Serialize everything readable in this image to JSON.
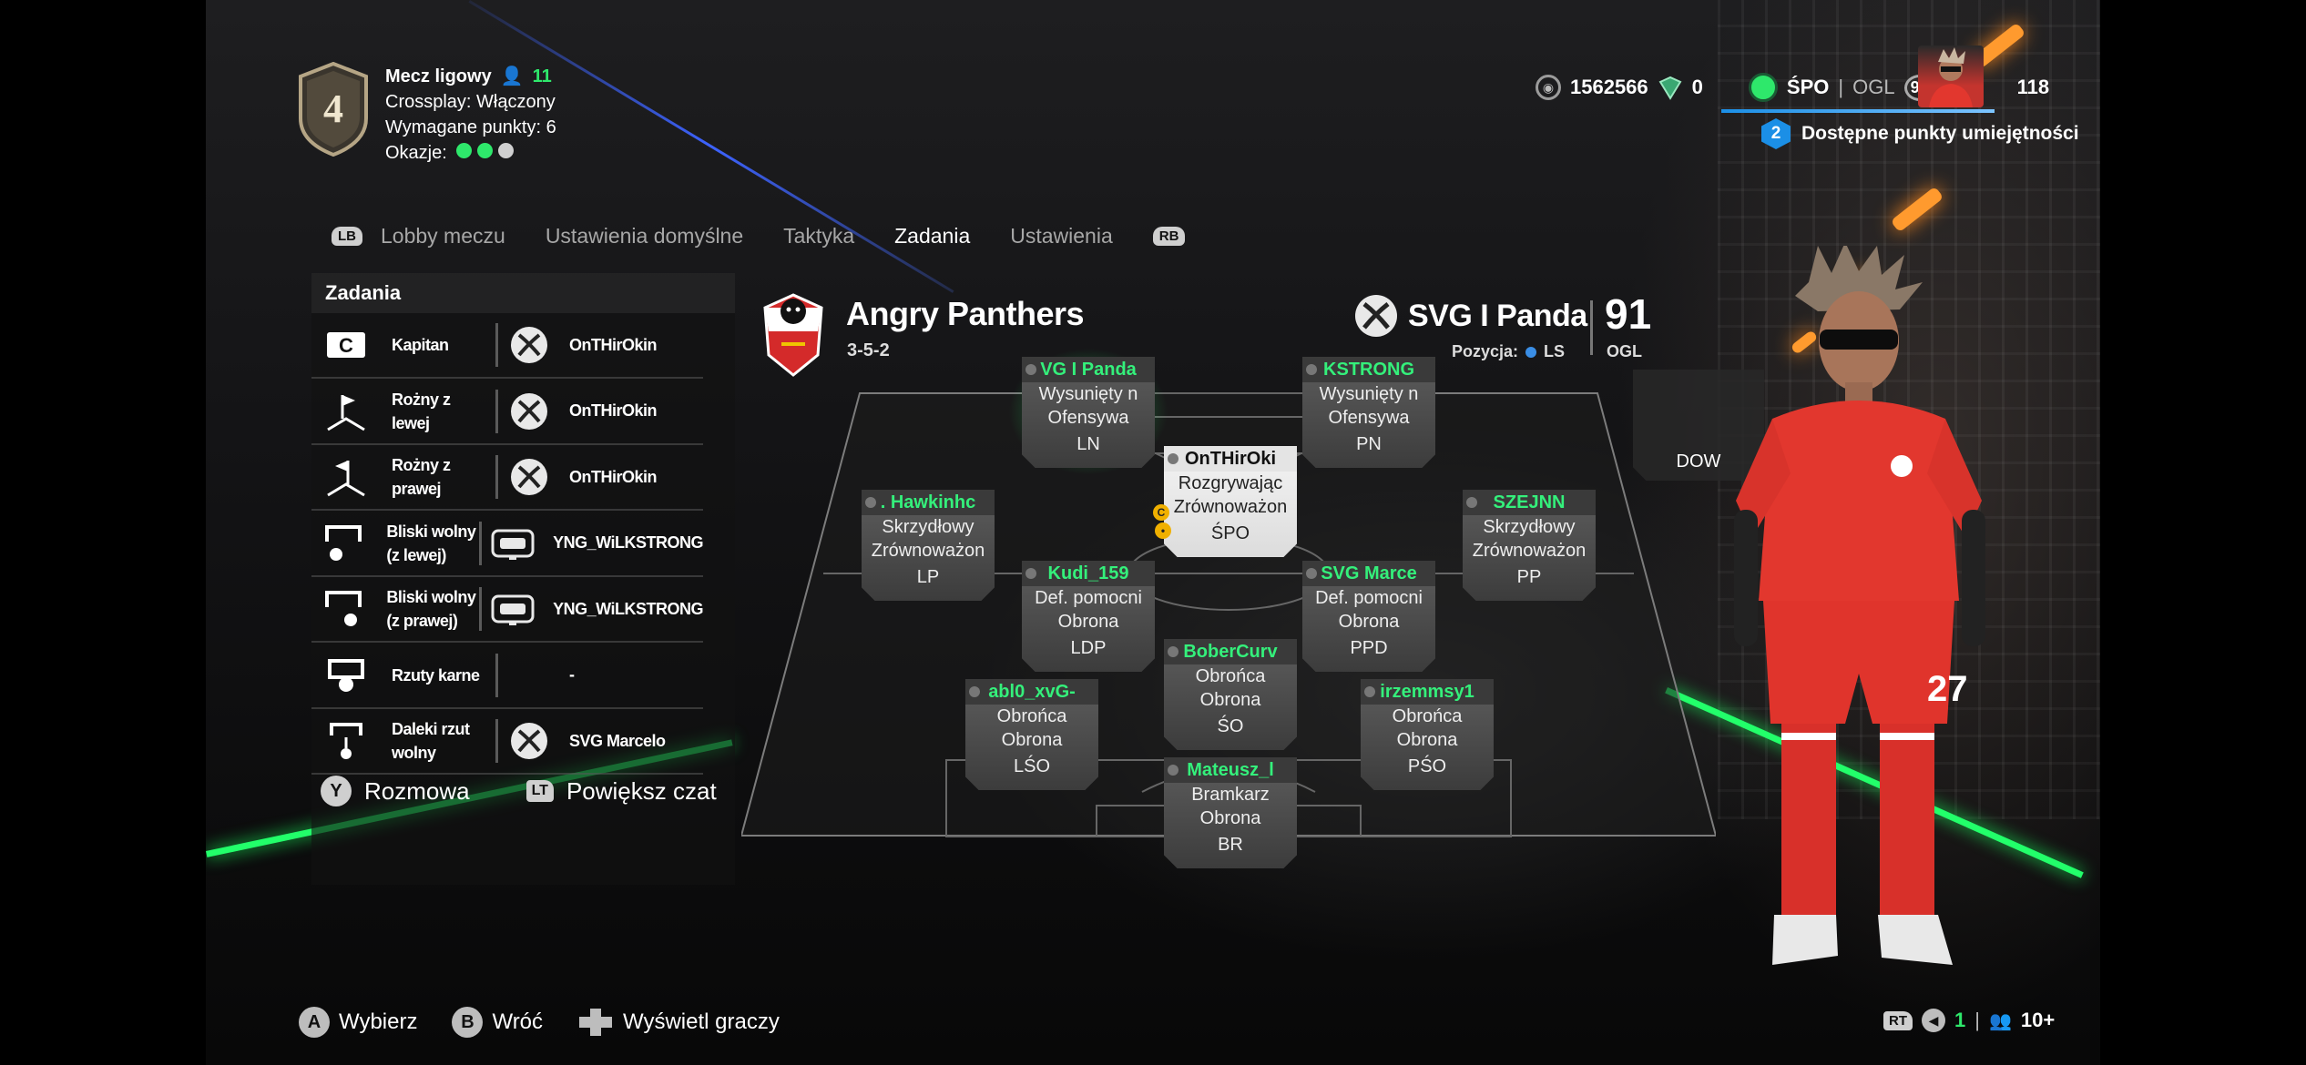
{
  "match": {
    "type_label": "Mecz ligowy",
    "players_count": "11",
    "crossplay": "Crossplay: Włączony",
    "required_points": "Wymagane punkty: 6",
    "chances_label": "Okazje:",
    "chances": [
      "#2ee86b",
      "#2ee86b",
      "#d0d0d0"
    ],
    "rank": "4"
  },
  "currency": {
    "coins": "1562566",
    "points": "0",
    "position": "ŚPO",
    "ovr_label": "OGL",
    "ovr": "92",
    "level": "118"
  },
  "skill_points": {
    "count": "2",
    "label": "Dostępne punkty umiejętności"
  },
  "tabs": {
    "left_bumper": "LB",
    "right_bumper": "RB",
    "items": [
      {
        "label": "Lobby meczu"
      },
      {
        "label": "Ustawienia domyślne"
      },
      {
        "label": "Taktyka"
      },
      {
        "label": "Zadania"
      },
      {
        "label": "Ustawienia"
      }
    ]
  },
  "tasks": {
    "title": "Zadania",
    "rows": [
      {
        "icon": "captain-icon",
        "label": "Kapitan",
        "platform": "xbox-icon",
        "player": "OnTHirOkin"
      },
      {
        "icon": "corner-left-icon",
        "label": "Rożny z lewej",
        "platform": "xbox-icon",
        "player": "OnTHirOkin"
      },
      {
        "icon": "corner-right-icon",
        "label": "Rożny z prawej",
        "platform": "xbox-icon",
        "player": "OnTHirOkin"
      },
      {
        "icon": "free-kick-near-left-icon",
        "label": "Bliski wolny (z lewej)",
        "platform": "playstation-icon",
        "player": "YNG_WiLKSTRONG"
      },
      {
        "icon": "free-kick-near-right-icon",
        "label": "Bliski wolny (z prawej)",
        "platform": "playstation-icon",
        "player": "YNG_WiLKSTRONG"
      },
      {
        "icon": "penalty-icon",
        "label": "Rzuty karne",
        "platform": "",
        "player": "-"
      },
      {
        "icon": "free-kick-far-icon",
        "label": "Daleki rzut wolny",
        "platform": "xbox-icon",
        "player": "SVG Marcelo"
      }
    ],
    "chat_button": "Y",
    "chat_label": "Rozmowa",
    "zoom_button": "LT",
    "zoom_label": "Powiększ czat"
  },
  "team": {
    "name": "Angry Panthers",
    "formation": "3-5-2"
  },
  "selected_player": {
    "name": "SVG I Panda",
    "rating": "91",
    "rating_label": "OGL",
    "position_label": "Pozycja:",
    "position": "LS"
  },
  "players": {
    "ln": {
      "name": "VG I Panda",
      "role1": "Wysunięty n",
      "role2": "Ofensywa",
      "pos": "LN"
    },
    "pn": {
      "name": "KSTRONG",
      "role1": "Wysunięty n",
      "role2": "Ofensywa",
      "pos": "PN"
    },
    "spo": {
      "name": "OnTHirOki",
      "role1": "Rozgrywając",
      "role2": "Zrównoważon",
      "pos": "ŚPO"
    },
    "lp": {
      "name": ". Hawkinhc",
      "role1": "Skrzydłowy",
      "role2": "Zrównoważon",
      "pos": "LP"
    },
    "pp": {
      "name": "SZEJNN",
      "role1": "Skrzydłowy",
      "role2": "Zrównoważon",
      "pos": "PP"
    },
    "ldp": {
      "name": "Kudi_159",
      "role1": "Def. pomocni",
      "role2": "Obrona",
      "pos": "LDP"
    },
    "ppd": {
      "name": "SVG Marce",
      "role1": "Def. pomocni",
      "role2": "Obrona",
      "pos": "PPD"
    },
    "so": {
      "name": "BoberCurv",
      "role1": "Obrońca",
      "role2": "Obrona",
      "pos": "ŚO"
    },
    "lso": {
      "name": "abl0_xvG-",
      "role1": "Obrońca",
      "role2": "Obrona",
      "pos": "LŚO"
    },
    "pso": {
      "name": "irzemmsy1",
      "role1": "Obrońca",
      "role2": "Obrona",
      "pos": "PŚO"
    },
    "br": {
      "name": "Mateusz_l",
      "role1": "Bramkarz",
      "role2": "Obrona",
      "pos": "BR"
    }
  },
  "side_card": {
    "label": "DOW"
  },
  "bottom": {
    "a_button": "A",
    "a_label": "Wybierz",
    "b_button": "B",
    "b_label": "Wróć",
    "view_label": "Wyświetl graczy",
    "rt_button": "RT",
    "mic_count": "1",
    "viewers": "10+"
  }
}
